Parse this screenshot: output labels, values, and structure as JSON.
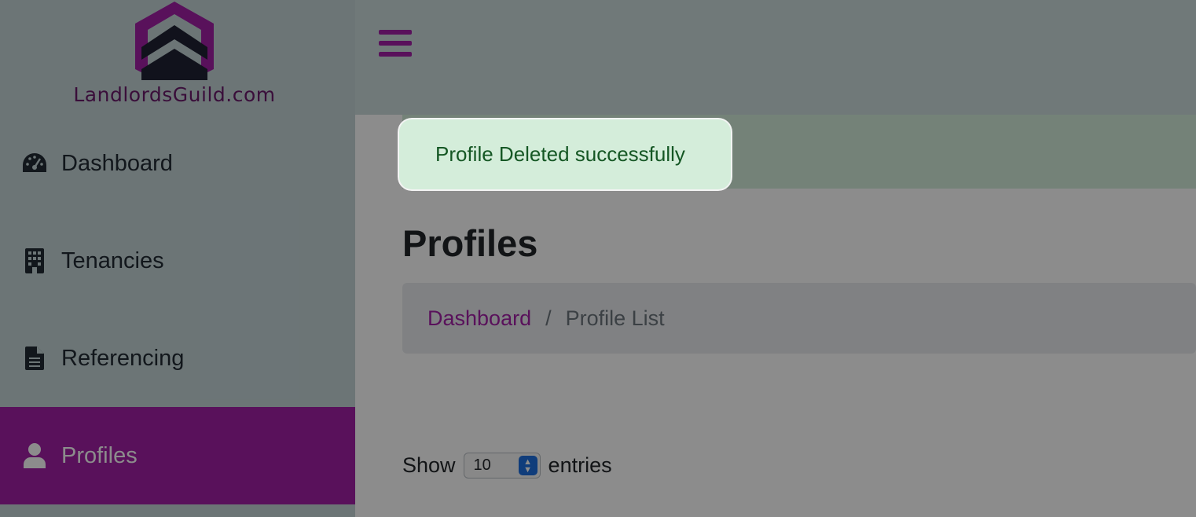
{
  "brand": {
    "logo_text": "LandlordsGuild.com",
    "primary_color": "#a31fa6",
    "dark_color": "#1f2233"
  },
  "sidebar": {
    "items": [
      {
        "label": "Dashboard",
        "icon": "dashboard-gauge-icon",
        "active": false
      },
      {
        "label": "Tenancies",
        "icon": "building-icon",
        "active": false
      },
      {
        "label": "Referencing",
        "icon": "document-icon",
        "active": false
      },
      {
        "label": "Profiles",
        "icon": "user-icon",
        "active": true
      }
    ]
  },
  "topbar": {
    "menu_icon": "hamburger-menu-icon"
  },
  "main": {
    "title": "Profiles",
    "breadcrumb": {
      "link": "Dashboard",
      "separator": "/",
      "current": "Profile List"
    },
    "length_menu": {
      "prefix": "Show",
      "value": "10",
      "suffix": "entries"
    }
  },
  "toast": {
    "message": "Profile Deleted successfully",
    "bg_color": "#d4edda",
    "text_color": "#155724"
  }
}
